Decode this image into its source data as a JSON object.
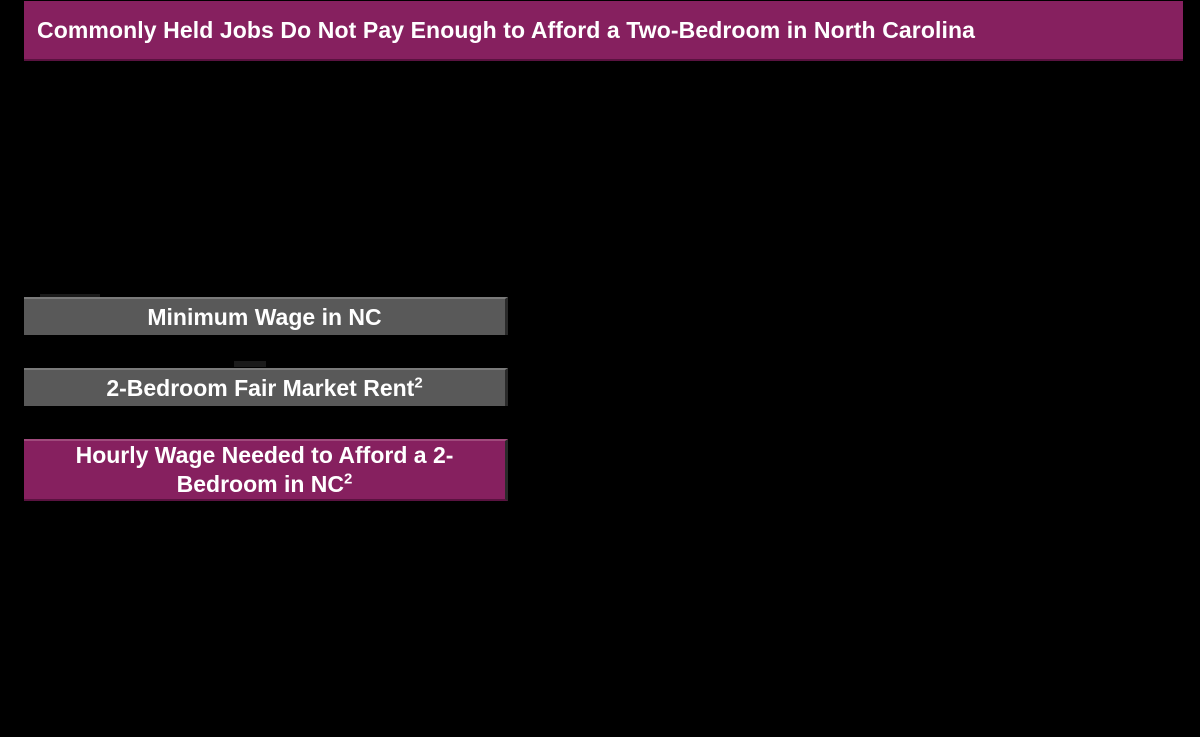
{
  "header": {
    "title": "Commonly Held Jobs Do Not Pay Enough to Afford a Two-Bedroom in North Carolina"
  },
  "rows": [
    {
      "label": "Minimum Wage in NC",
      "sup": ""
    },
    {
      "label": "2-Bedroom Fair Market Rent",
      "sup": "2"
    },
    {
      "label_line1": "Hourly Wage Needed to Afford a 2-",
      "label_line2": "Bedroom in NC",
      "sup": "2"
    }
  ],
  "colors": {
    "background": "#000000",
    "brand_purple": "#86205f",
    "row_gray": "#595959",
    "text": "#ffffff"
  }
}
